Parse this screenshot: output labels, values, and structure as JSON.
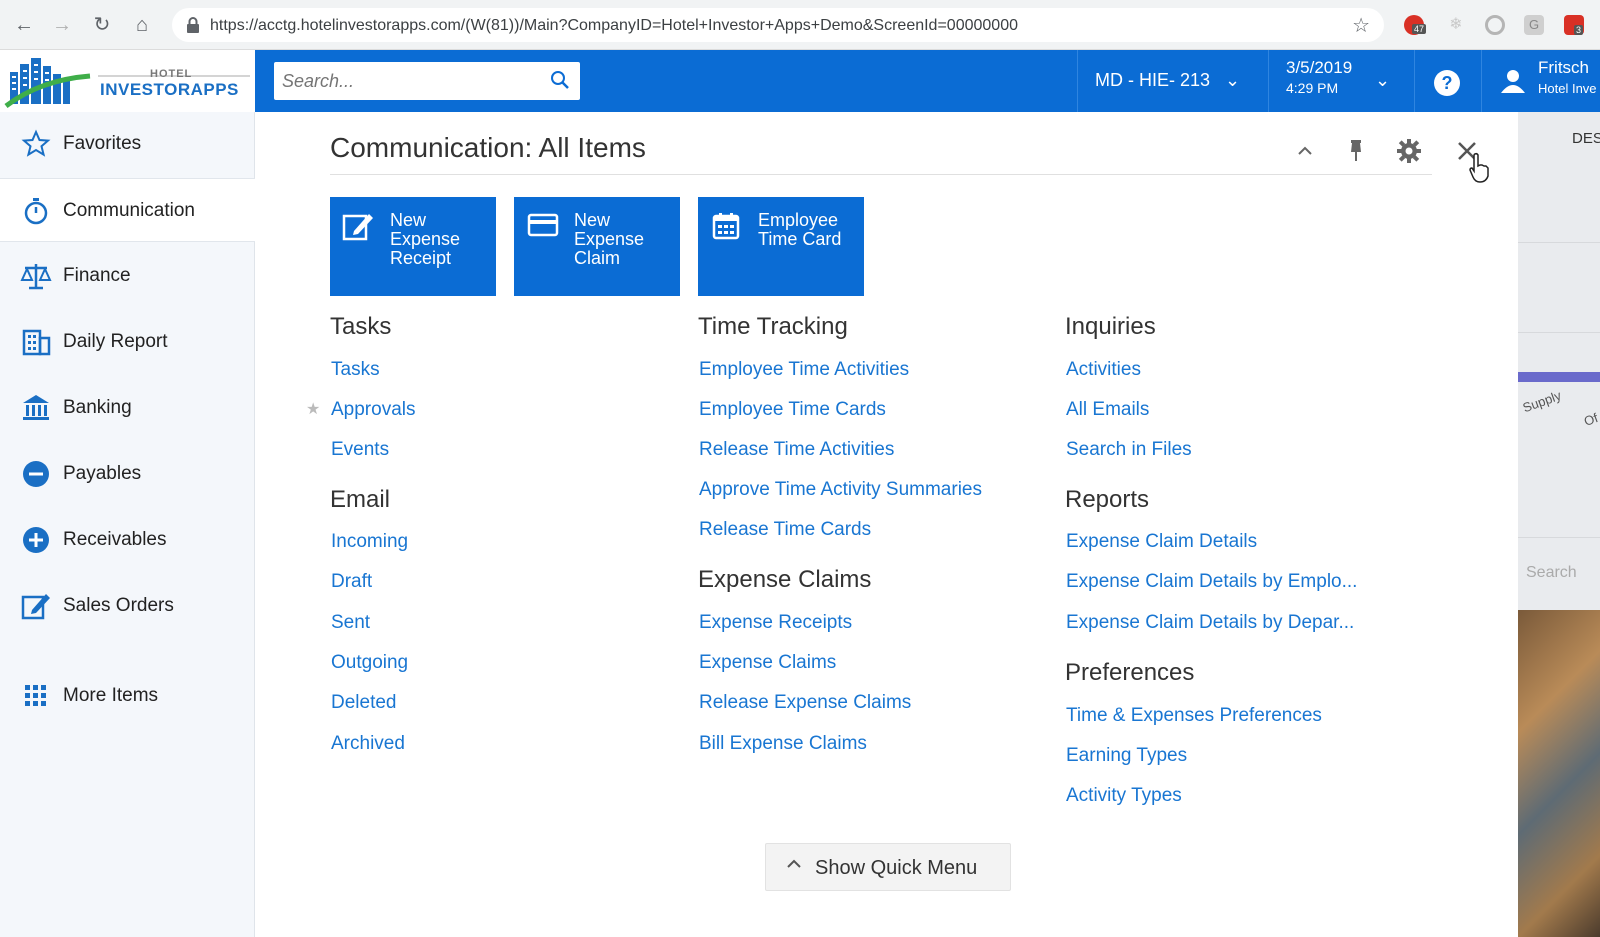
{
  "browser": {
    "url": "https://acctg.hotelinvestorapps.com/(W(81))/Main?CompanyID=Hotel+Investor+Apps+Demo&ScreenId=00000000",
    "ext_badge_1": "47",
    "ext_badge_2": "3"
  },
  "header": {
    "logo_line1": "HOTEL",
    "logo_line2": "INVESTORAPPS",
    "search_placeholder": "Search...",
    "branch": "MD - HIE- 213",
    "date": "3/5/2019",
    "time": "4:29 PM",
    "help": "?",
    "user_name": "Fritsch",
    "user_company": "Hotel Inve"
  },
  "sidebar": {
    "items": [
      {
        "label": "Favorites"
      },
      {
        "label": "Communication"
      },
      {
        "label": "Finance"
      },
      {
        "label": "Daily Report"
      },
      {
        "label": "Banking"
      },
      {
        "label": "Payables"
      },
      {
        "label": "Receivables"
      },
      {
        "label": "Sales Orders"
      },
      {
        "label": "More Items"
      }
    ]
  },
  "panel": {
    "title": "Communication: All Items",
    "tiles": [
      {
        "label": "New Expense Receipt"
      },
      {
        "label": "New Expense Claim"
      },
      {
        "label": "Employee Time Card"
      }
    ],
    "col1": {
      "tasks_head": "Tasks",
      "tasks": [
        "Tasks",
        "Approvals",
        "Events"
      ],
      "email_head": "Email",
      "email": [
        "Incoming",
        "Draft",
        "Sent",
        "Outgoing",
        "Deleted",
        "Archived"
      ]
    },
    "col2": {
      "tt_head": "Time Tracking",
      "tt": [
        "Employee Time Activities",
        "Employee Time Cards",
        "Release Time Activities",
        "Approve Time Activity Summaries",
        "Release Time Cards"
      ],
      "ec_head": "Expense Claims",
      "ec": [
        "Expense Receipts",
        "Expense Claims",
        "Release Expense Claims",
        "Bill Expense Claims"
      ]
    },
    "col3": {
      "inq_head": "Inquiries",
      "inq": [
        "Activities",
        "All Emails",
        "Search in Files"
      ],
      "rep_head": "Reports",
      "rep": [
        "Expense Claim Details",
        "Expense Claim Details by Emplo...",
        "Expense Claim Details by Depar..."
      ],
      "pref_head": "Preferences",
      "pref": [
        "Time & Expenses Preferences",
        "Earning Types",
        "Activity Types"
      ]
    },
    "quick_menu": "Show Quick Menu"
  },
  "background": {
    "des": "DES",
    "search": "Search",
    "supply": "Supply",
    "off": "Of"
  },
  "colors": {
    "brand_blue": "#0b6cd4",
    "link_blue": "#1976d2"
  }
}
